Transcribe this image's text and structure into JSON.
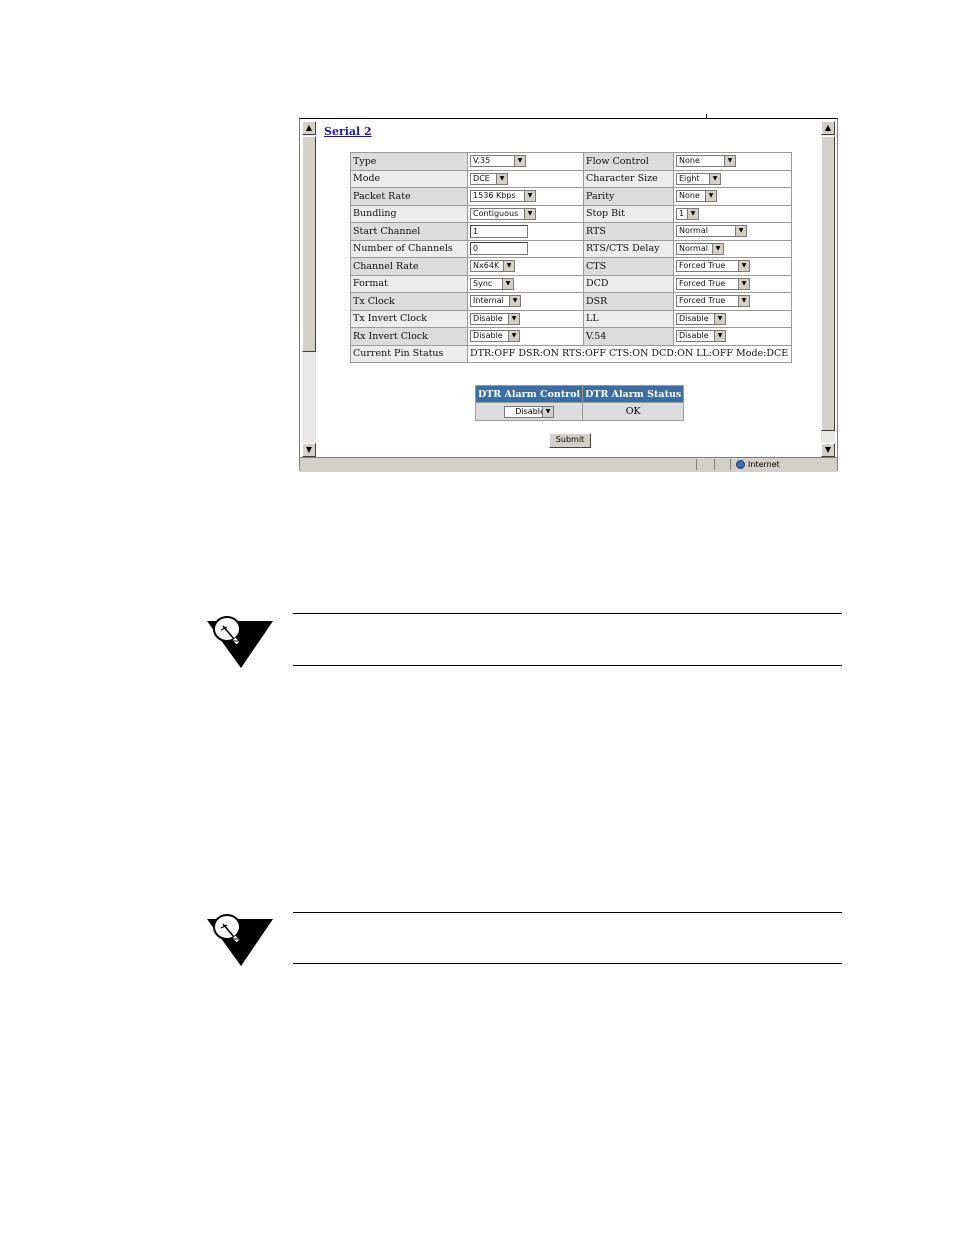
{
  "page": {
    "link_title": "Serial 2"
  },
  "config_rows": [
    {
      "l1": "Type",
      "v1": "V.35",
      "l2": "Flow Control",
      "v2": "None"
    },
    {
      "l1": "Mode",
      "v1": "DCE",
      "l2": "Character Size",
      "v2": "Eight"
    },
    {
      "l1": "Packet Rate",
      "v1": "1536 Kbps",
      "l2": "Parity",
      "v2": "None"
    },
    {
      "l1": "Bundling",
      "v1": "Contiguous",
      "l2": "Stop Bit",
      "v2": "1"
    },
    {
      "l1": "Start Channel",
      "v1": "1",
      "l2": "RTS",
      "v2": "Normal"
    },
    {
      "l1": "Number of Channels",
      "v1": "0",
      "l2": "RTS/CTS Delay",
      "v2": "Normal"
    },
    {
      "l1": "Channel Rate",
      "v1": "Nx64K",
      "l2": "CTS",
      "v2": "Forced True"
    },
    {
      "l1": "Format",
      "v1": "Sync",
      "l2": "DCD",
      "v2": "Forced True"
    },
    {
      "l1": "Tx Clock",
      "v1": "Internal",
      "l2": "DSR",
      "v2": "Forced True"
    },
    {
      "l1": "Tx Invert Clock",
      "v1": "Disable",
      "l2": "LL",
      "v2": "Disable"
    },
    {
      "l1": "Rx Invert Clock",
      "v1": "Disable",
      "l2": "V.54",
      "v2": "Disable"
    }
  ],
  "pin_status": {
    "label": "Current Pin Status",
    "value": "DTR:OFF DSR:ON RTS:OFF CTS:ON DCD:ON LL:OFF Mode:DCE"
  },
  "alarm": {
    "control_header": "DTR Alarm Control",
    "status_header": "DTR Alarm Status",
    "control_value": "Disable",
    "status_value": "OK"
  },
  "submit_label": "Submit",
  "statusbar": {
    "zone": "Internet"
  },
  "icons": {
    "note": "lightbulb-note-icon",
    "scroll_up": "up-arrow-icon",
    "scroll_down": "down-arrow-icon"
  }
}
